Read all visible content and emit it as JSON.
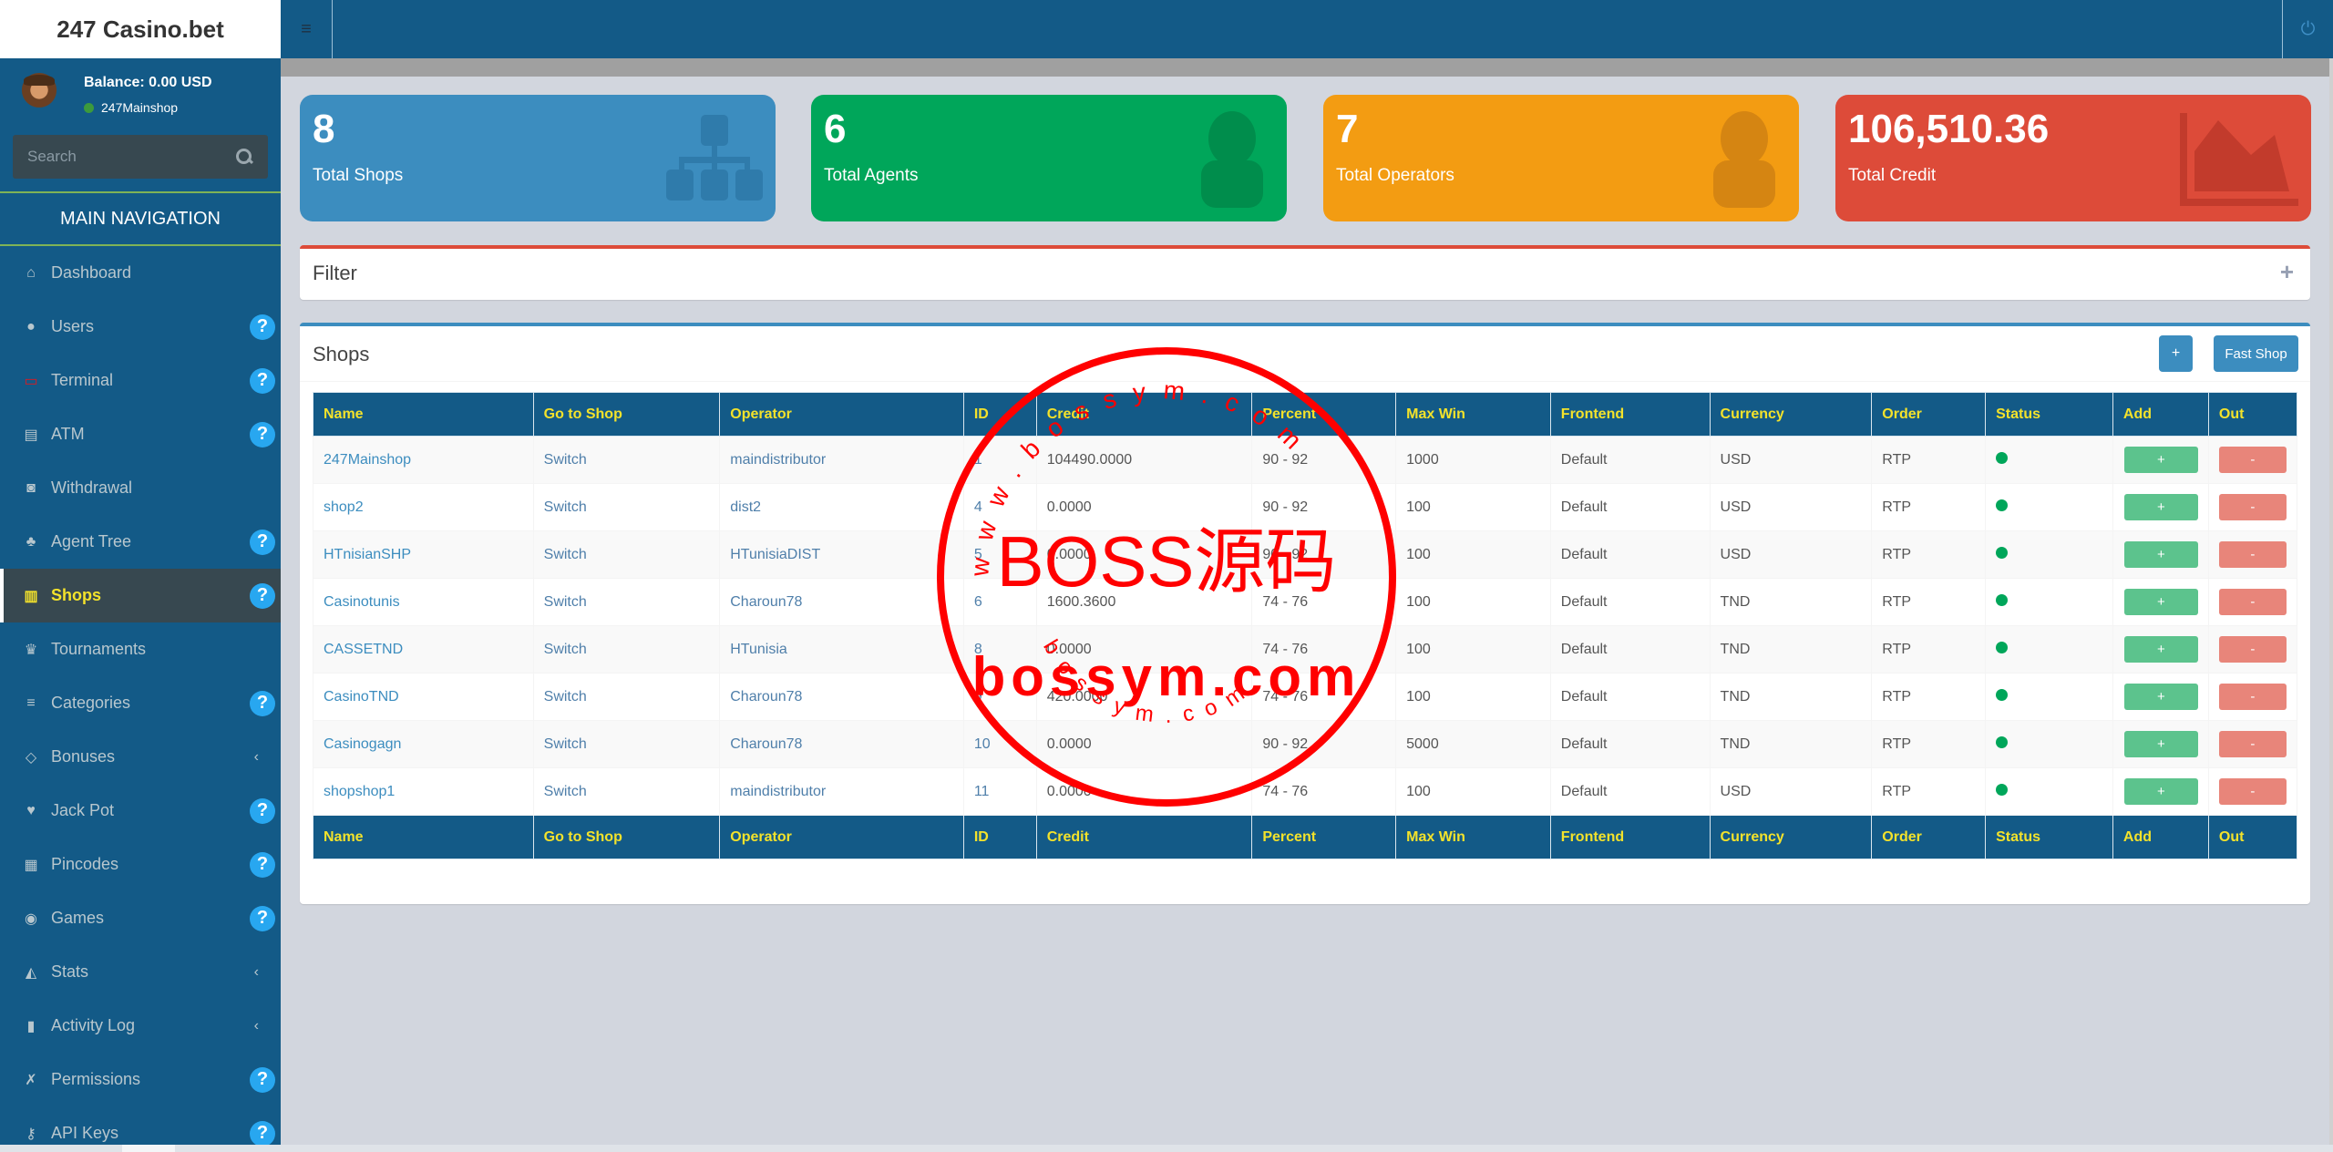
{
  "app": {
    "title": "247 Casino.bet"
  },
  "user": {
    "balance": "Balance: 0.00 USD",
    "shop": "247Mainshop"
  },
  "search": {
    "placeholder": "Search"
  },
  "sidebar": {
    "header": "MAIN NAVIGATION",
    "items": [
      {
        "label": "Dashboard",
        "icon": "home-icon",
        "glyph": "⌂",
        "help": false,
        "chevron": false,
        "active": false
      },
      {
        "label": "Users",
        "icon": "user-icon",
        "glyph": "●",
        "help": true,
        "chevron": false,
        "active": false
      },
      {
        "label": "Terminal",
        "icon": "monitor-icon",
        "glyph": "▭",
        "help": true,
        "chevron": false,
        "active": false
      },
      {
        "label": "ATM",
        "icon": "credit-card-icon",
        "glyph": "▤",
        "help": true,
        "chevron": false,
        "active": false
      },
      {
        "label": "Withdrawal",
        "icon": "money-icon",
        "glyph": "◙",
        "help": false,
        "chevron": false,
        "active": false
      },
      {
        "label": "Agent Tree",
        "icon": "tree-icon",
        "glyph": "♣",
        "help": true,
        "chevron": false,
        "active": false
      },
      {
        "label": "Shops",
        "icon": "bank-icon",
        "glyph": "▥",
        "help": true,
        "chevron": false,
        "active": true
      },
      {
        "label": "Tournaments",
        "icon": "trophy-icon",
        "glyph": "♛",
        "help": false,
        "chevron": false,
        "active": false
      },
      {
        "label": "Categories",
        "icon": "list-icon",
        "glyph": "≡",
        "help": true,
        "chevron": false,
        "active": false
      },
      {
        "label": "Bonuses",
        "icon": "diamond-icon",
        "glyph": "◇",
        "help": false,
        "chevron": true,
        "active": false
      },
      {
        "label": "Jack Pot",
        "icon": "heartbeat-icon",
        "glyph": "♥",
        "help": true,
        "chevron": false,
        "active": false
      },
      {
        "label": "Pincodes",
        "icon": "qrcode-icon",
        "glyph": "▦",
        "help": true,
        "chevron": false,
        "active": false
      },
      {
        "label": "Games",
        "icon": "gamepad-icon",
        "glyph": "◉",
        "help": true,
        "chevron": false,
        "active": false
      },
      {
        "label": "Stats",
        "icon": "area-chart-icon",
        "glyph": "◭",
        "help": false,
        "chevron": true,
        "active": false
      },
      {
        "label": "Activity Log",
        "icon": "bar-chart-icon",
        "glyph": "▮",
        "help": false,
        "chevron": true,
        "active": false
      },
      {
        "label": "Permissions",
        "icon": "permissions-icon",
        "glyph": "✗",
        "help": true,
        "chevron": false,
        "active": false
      },
      {
        "label": "API Keys",
        "icon": "key-icon",
        "glyph": "⚷",
        "help": true,
        "chevron": false,
        "active": false
      }
    ],
    "help_glyph": "?",
    "chevron_glyph": "‹"
  },
  "topbar": {
    "menu_glyph": "≡",
    "power_glyph": "⏻"
  },
  "stats": [
    {
      "value": "8",
      "label": "Total Shops",
      "color": "#3c8dbf",
      "icon": "sitemap-icon"
    },
    {
      "value": "6",
      "label": "Total Agents",
      "color": "#00a65a",
      "icon": "user-icon"
    },
    {
      "value": "7",
      "label": "Total Operators",
      "color": "#f39c12",
      "icon": "user-icon"
    },
    {
      "value": "106,510.36",
      "label": "Total Credit",
      "color": "#dd4b39",
      "icon": "area-chart-icon"
    }
  ],
  "filter": {
    "title": "Filter",
    "expand_glyph": "+"
  },
  "shops": {
    "title": "Shops",
    "add_button": "+",
    "fast_shop_button": "Fast Shop",
    "columns": [
      "Name",
      "Go to Shop",
      "Operator",
      "ID",
      "Credit",
      "Percent",
      "Max Win",
      "Frontend",
      "Currency",
      "Order",
      "Status",
      "Add",
      "Out"
    ],
    "rows": [
      {
        "name": "247Mainshop",
        "go": "Switch",
        "operator": "maindistributor",
        "id": "1",
        "credit": "104490.0000",
        "percent": "90 - 92",
        "max_win": "1000",
        "frontend": "Default",
        "currency": "USD",
        "order": "RTP",
        "status": "active",
        "add": "+",
        "out": "-"
      },
      {
        "name": "shop2",
        "go": "Switch",
        "operator": "dist2",
        "id": "4",
        "credit": "0.0000",
        "percent": "90 - 92",
        "max_win": "100",
        "frontend": "Default",
        "currency": "USD",
        "order": "RTP",
        "status": "active",
        "add": "+",
        "out": "-"
      },
      {
        "name": "HTnisianSHP",
        "go": "Switch",
        "operator": "HTunisiaDIST",
        "id": "5",
        "credit": "0.0000",
        "percent": "90 - 92",
        "max_win": "100",
        "frontend": "Default",
        "currency": "USD",
        "order": "RTP",
        "status": "active",
        "add": "+",
        "out": "-"
      },
      {
        "name": "Casinotunis",
        "go": "Switch",
        "operator": "Charoun78",
        "id": "6",
        "credit": "1600.3600",
        "percent": "74 - 76",
        "max_win": "100",
        "frontend": "Default",
        "currency": "TND",
        "order": "RTP",
        "status": "active",
        "add": "+",
        "out": "-"
      },
      {
        "name": "CASSETND",
        "go": "Switch",
        "operator": "HTunisia",
        "id": "8",
        "credit": "0.0000",
        "percent": "74 - 76",
        "max_win": "100",
        "frontend": "Default",
        "currency": "TND",
        "order": "RTP",
        "status": "active",
        "add": "+",
        "out": "-"
      },
      {
        "name": "CasinoTND",
        "go": "Switch",
        "operator": "Charoun78",
        "id": "9",
        "credit": "420.0000",
        "percent": "74 - 76",
        "max_win": "100",
        "frontend": "Default",
        "currency": "TND",
        "order": "RTP",
        "status": "active",
        "add": "+",
        "out": "-"
      },
      {
        "name": "Casinogagn",
        "go": "Switch",
        "operator": "Charoun78",
        "id": "10",
        "credit": "0.0000",
        "percent": "90 - 92",
        "max_win": "5000",
        "frontend": "Default",
        "currency": "TND",
        "order": "RTP",
        "status": "active",
        "add": "+",
        "out": "-"
      },
      {
        "name": "shopshop1",
        "go": "Switch",
        "operator": "maindistributor",
        "id": "11",
        "credit": "0.0000",
        "percent": "74 - 76",
        "max_win": "100",
        "frontend": "Default",
        "currency": "USD",
        "order": "RTP",
        "status": "active",
        "add": "+",
        "out": "-"
      }
    ]
  },
  "watermark": {
    "main": "BOSS源码",
    "url": "bossym.com",
    "ring_top": "www.bossym.com",
    "ring_bottom": "bossym.com",
    "color": "#ff0000"
  }
}
